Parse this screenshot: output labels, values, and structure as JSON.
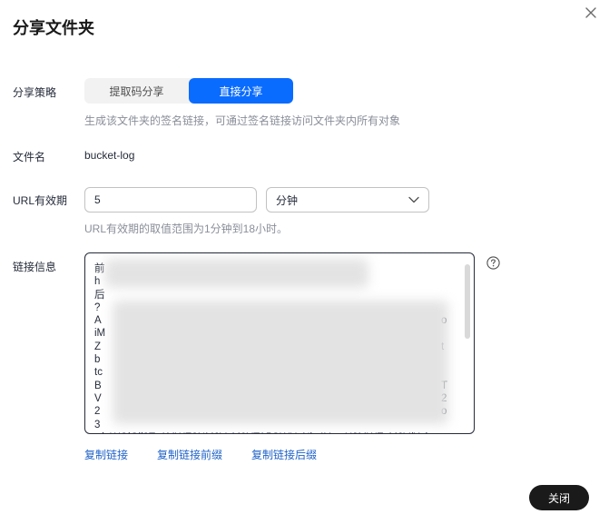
{
  "dialog": {
    "title": "分享文件夹",
    "close_icon": "close-icon"
  },
  "share_strategy": {
    "label": "分享策略",
    "options": [
      {
        "label": "提取码分享",
        "selected": false
      },
      {
        "label": "直接分享",
        "selected": true
      }
    ],
    "hint": "生成该文件夹的签名链接，可通过签名链接访问文件夹内所有对象"
  },
  "file_name": {
    "label": "文件名",
    "value": "bucket-log"
  },
  "url_validity": {
    "label": "URL有效期",
    "value": "5",
    "unit": "分钟",
    "hint": "URL有效期的取值范围为1分钟到18小时。"
  },
  "link_info": {
    "label": "链接信息",
    "visible_lines": [
      "前",
      "h",
      "后",
      "?",
      "A",
      "iM",
      "Z",
      "b",
      "tc",
      "B",
      "V",
      "2",
      "3",
      "wjaWOiOjl3Tz1MWE3NM2VzM0YTA5OWUyNjg4YzmU3MWEzM2V/Xyl"
    ],
    "right_fragments": [
      "o",
      "t",
      "T",
      "2",
      "o"
    ],
    "help_icon": "question-circle-icon"
  },
  "link_actions": {
    "copy_link": "复制链接",
    "copy_prefix": "复制链接前缀",
    "copy_suffix": "复制链接后缀"
  },
  "footer": {
    "close_label": "关闭"
  },
  "colors": {
    "primary": "#0a6cff",
    "link": "#1f62c9",
    "dark_button": "#1a1a1a"
  }
}
